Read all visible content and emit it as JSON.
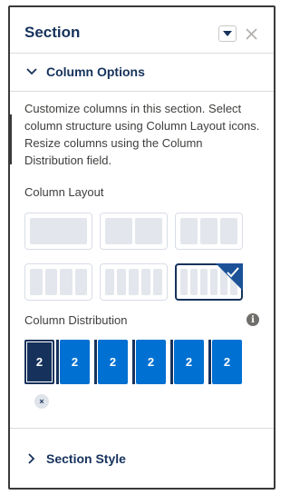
{
  "panel": {
    "title": "Section",
    "menu_icon": "chevron-down-icon",
    "close_icon": "close-icon"
  },
  "column_options": {
    "label": "Column Options",
    "expanded": true,
    "description": "Customize columns in this section. Select column structure using Column Layout icons. Resize columns using the Column Distribution field.",
    "layout_label": "Column Layout",
    "layouts": [
      {
        "columns": 1,
        "selected": false
      },
      {
        "columns": 2,
        "selected": false
      },
      {
        "columns": 3,
        "selected": false
      },
      {
        "columns": 4,
        "selected": false
      },
      {
        "columns": 5,
        "selected": false
      },
      {
        "columns": 6,
        "selected": true
      }
    ],
    "distribution_label": "Column Distribution",
    "distribution": [
      "2",
      "2",
      "2",
      "2",
      "2",
      "2"
    ],
    "remove_label": "×"
  },
  "section_style": {
    "label": "Section Style",
    "expanded": false
  },
  "colors": {
    "header_text": "#16325c",
    "column_fill": "#0070d2",
    "selected_column": "#16325c",
    "tile_fill": "#e3e6ec"
  }
}
